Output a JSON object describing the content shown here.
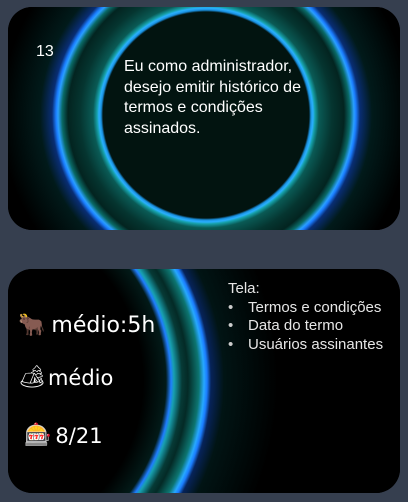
{
  "story_card": {
    "number": "13",
    "text": "Eu como administrador, desejo emitir histórico de termos e condições assinados."
  },
  "details_card": {
    "effort": {
      "icon": "ox-icon",
      "emoji": "🐂",
      "label": "médio:5h"
    },
    "complexity": {
      "icon": "camping-icon",
      "emoji": "🏕",
      "label": "médio"
    },
    "odds": {
      "icon": "slot-machine-icon",
      "emoji": "🎰",
      "label": "8/21"
    },
    "screen": {
      "title": "Tela:",
      "items": [
        "Termos e condições",
        "Data do termo",
        "Usuários assinantes"
      ]
    }
  }
}
